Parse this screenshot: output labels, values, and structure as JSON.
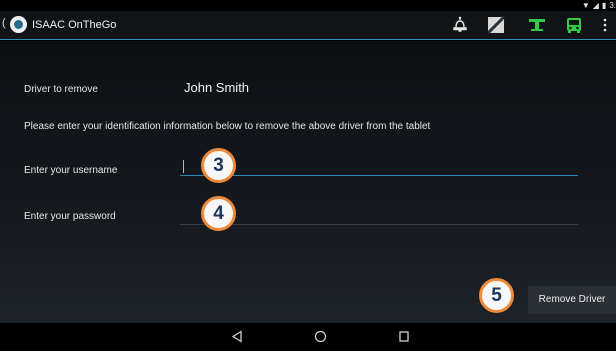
{
  "status_bar": {
    "wifi_icon": "wifi-icon",
    "signal_icon": "signal-icon",
    "battery_icon": "battery-icon",
    "time": "3:"
  },
  "action_bar": {
    "app_title": "ISAAC OnTheGo",
    "icons": [
      "bell-icon",
      "square-icon",
      "signal-tower-icon",
      "bus-icon",
      "overflow-menu-icon"
    ],
    "accent_color": "#2e8fb8",
    "green_color": "#35c94a"
  },
  "form": {
    "driver_label": "Driver to remove",
    "driver_value": "John Smith",
    "instructions": "Please enter your identification information below to remove the above driver from the tablet",
    "username_label": "Enter your username",
    "username_value": "",
    "password_label": "Enter your password",
    "password_value": "",
    "remove_button_label": "Remove Driver"
  },
  "annotations": {
    "badge_3": "3",
    "badge_4": "4",
    "badge_5": "5",
    "badge_border_color": "#ef8a3a",
    "badge_text_color": "#1c3557"
  },
  "nav_bar": {
    "icons": [
      "back-icon",
      "home-icon",
      "recents-icon"
    ]
  }
}
